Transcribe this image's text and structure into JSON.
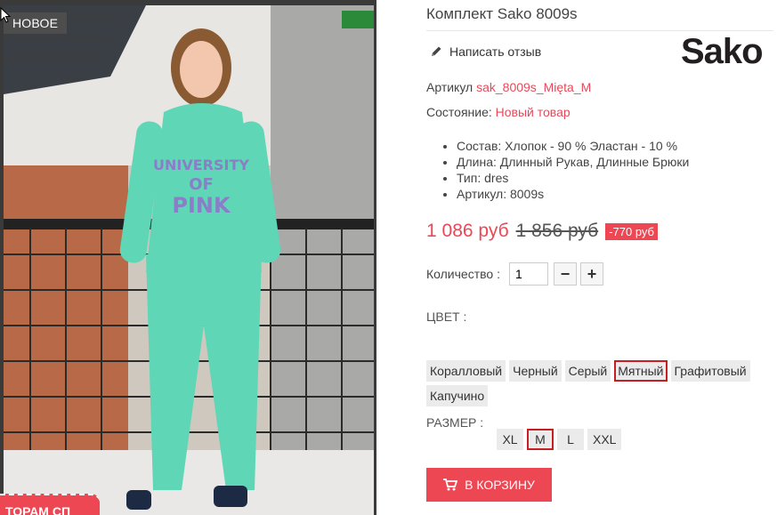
{
  "product": {
    "title": "Комплект Sako 8009s",
    "badge": "НОВОЕ",
    "promo": "ТОРАМ СП",
    "brand_logo": "Sako",
    "review_link": "Написать отзыв",
    "sku_label": "Артикул",
    "sku_value": "sak_8009s_Mięta_M",
    "condition_label": "Состояние:",
    "condition_value": "Новый товар",
    "specs": [
      "Состав: Хлопок - 90 % Эластан - 10 %",
      "Длина: Длинный Рукав, Длинные Брюки",
      "Тип: dres",
      "Артикул: 8009s"
    ],
    "price_new": "1 086 руб",
    "price_old": "1 856 руб",
    "discount": "-770 руб",
    "quantity_label": "Количество :",
    "quantity_value": "1",
    "qty_minus": "−",
    "qty_plus": "+",
    "color_label": "ЦВЕТ :",
    "colors": [
      "Коралловый",
      "Черный",
      "Серый",
      "Мятный",
      "Графитовый",
      "Капучино"
    ],
    "color_selected": "Мятный",
    "size_label": "РАЗМЕР :",
    "sizes": [
      "XL",
      "M",
      "L",
      "XXL"
    ],
    "size_selected": "M",
    "cart_button": "В КОРЗИНУ"
  },
  "colors": {
    "accent": "#ee4754",
    "selected_border": "#c81d25",
    "option_bg": "#ebebeb",
    "outfit": "#5fd6b6"
  }
}
